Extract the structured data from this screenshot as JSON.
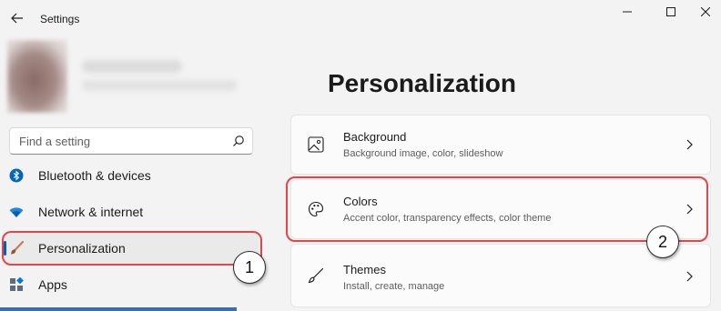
{
  "window": {
    "title": "Settings",
    "controls": {
      "minimize": "minimize-icon",
      "maximize": "maximize-icon",
      "close": "close-icon"
    }
  },
  "search": {
    "placeholder": "Find a setting"
  },
  "sidebar": {
    "items": [
      {
        "label": "Bluetooth & devices",
        "icon": "bluetooth-icon",
        "active": false
      },
      {
        "label": "Network & internet",
        "icon": "wifi-icon",
        "active": false
      },
      {
        "label": "Personalization",
        "icon": "brush-icon",
        "active": true
      },
      {
        "label": "Apps",
        "icon": "apps-icon",
        "active": false
      }
    ]
  },
  "main": {
    "title": "Personalization",
    "cards": [
      {
        "title": "Background",
        "subtitle": "Background image, color, slideshow",
        "icon": "image-icon"
      },
      {
        "title": "Colors",
        "subtitle": "Accent color, transparency effects, color theme",
        "icon": "palette-icon"
      },
      {
        "title": "Themes",
        "subtitle": "Install, create, manage",
        "icon": "pen-brush-icon"
      }
    ]
  },
  "annotations": {
    "callout_1": "1",
    "callout_2": "2"
  },
  "colors": {
    "accent": "#005fb8",
    "highlight": "#e2454a",
    "background": "#f3f3f3"
  }
}
